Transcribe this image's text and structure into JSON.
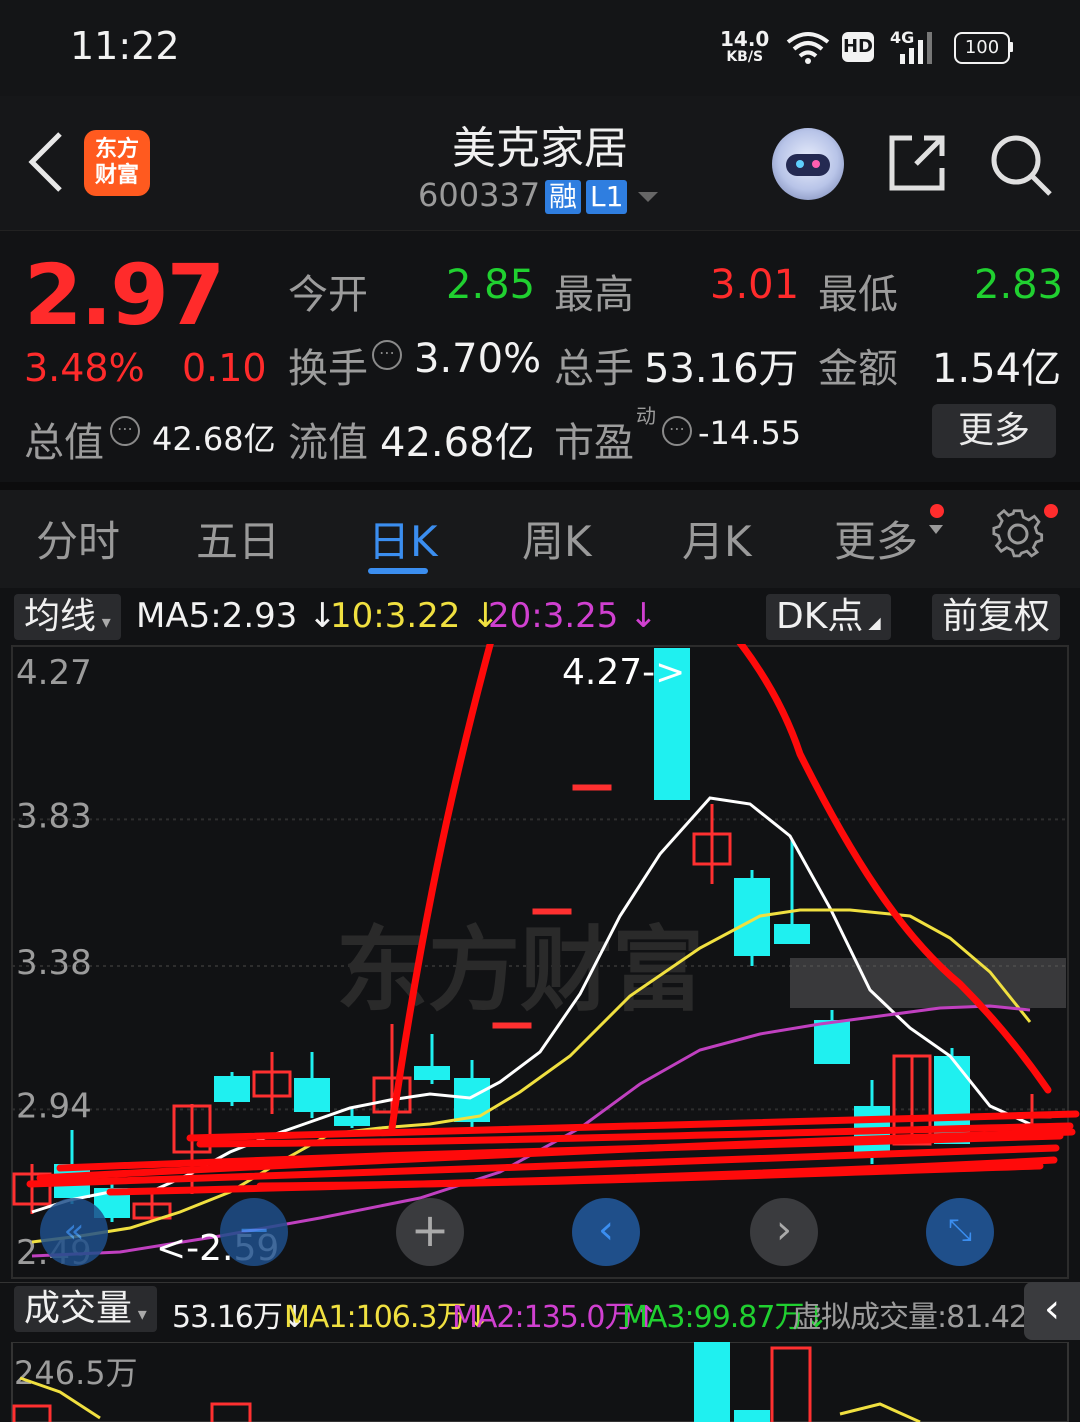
{
  "status_bar": {
    "time": "11:22",
    "net_speed_value": "14.0",
    "net_speed_unit": "KB/S",
    "hd_label": "HD",
    "signal_label": "4G",
    "battery": "100"
  },
  "header": {
    "logo_line1": "东方",
    "logo_line2": "财富",
    "stock_name": "美克家居",
    "stock_code": "600337",
    "badge_rong": "融",
    "badge_level": "L1"
  },
  "quote": {
    "price": "2.97",
    "change_pct": "3.48%",
    "change_amt": "0.10",
    "open_label": "今开",
    "open_value": "2.85",
    "high_label": "最高",
    "high_value": "3.01",
    "low_label": "最低",
    "low_value": "2.83",
    "turnover_label": "换手",
    "turnover_value": "3.70%",
    "volume_label": "总手",
    "volume_value": "53.16万",
    "amount_label": "金额",
    "amount_value": "1.54亿",
    "mktcap_label": "总值",
    "mktcap_value": "42.68亿",
    "float_label": "流值",
    "float_value": "42.68亿",
    "pe_label": "市盈",
    "pe_sup": "动",
    "pe_value": "-14.55",
    "more_label": "更多"
  },
  "tabs": [
    {
      "label": "分时"
    },
    {
      "label": "五日"
    },
    {
      "label": "日K"
    },
    {
      "label": "周K"
    },
    {
      "label": "月K"
    },
    {
      "label": "更多"
    }
  ],
  "ma_bar": {
    "selector_label": "均线",
    "ma5": "MA5:2.93",
    "ma10": "10:3.22",
    "ma20": "20:3.25",
    "dk_label": "DK点",
    "adjust_label": "前复权"
  },
  "chart_data": {
    "type": "candlestick",
    "y_ticks": [
      "4.27",
      "3.83",
      "3.38",
      "2.94",
      "2.49"
    ],
    "ylim": [
      2.49,
      4.27
    ],
    "max_label": "4.27->",
    "min_label": "<-2.59",
    "watermark": "东方财富",
    "colors": {
      "up": "#ff3030",
      "down": "#1ff0f0",
      "ma5": "#ffffff",
      "ma10": "#f0e040",
      "ma20": "#c040c0",
      "annotation": "#ff0000"
    }
  },
  "volume_bar": {
    "selector_label": "成交量",
    "vol": "53.16万",
    "ma1": "MA1:106.3万",
    "ma2": "MA2:135.0万",
    "ma3": "MA3:99.87万",
    "virtual": "虚拟成交量:81.42万",
    "y_top": "246.5万"
  }
}
